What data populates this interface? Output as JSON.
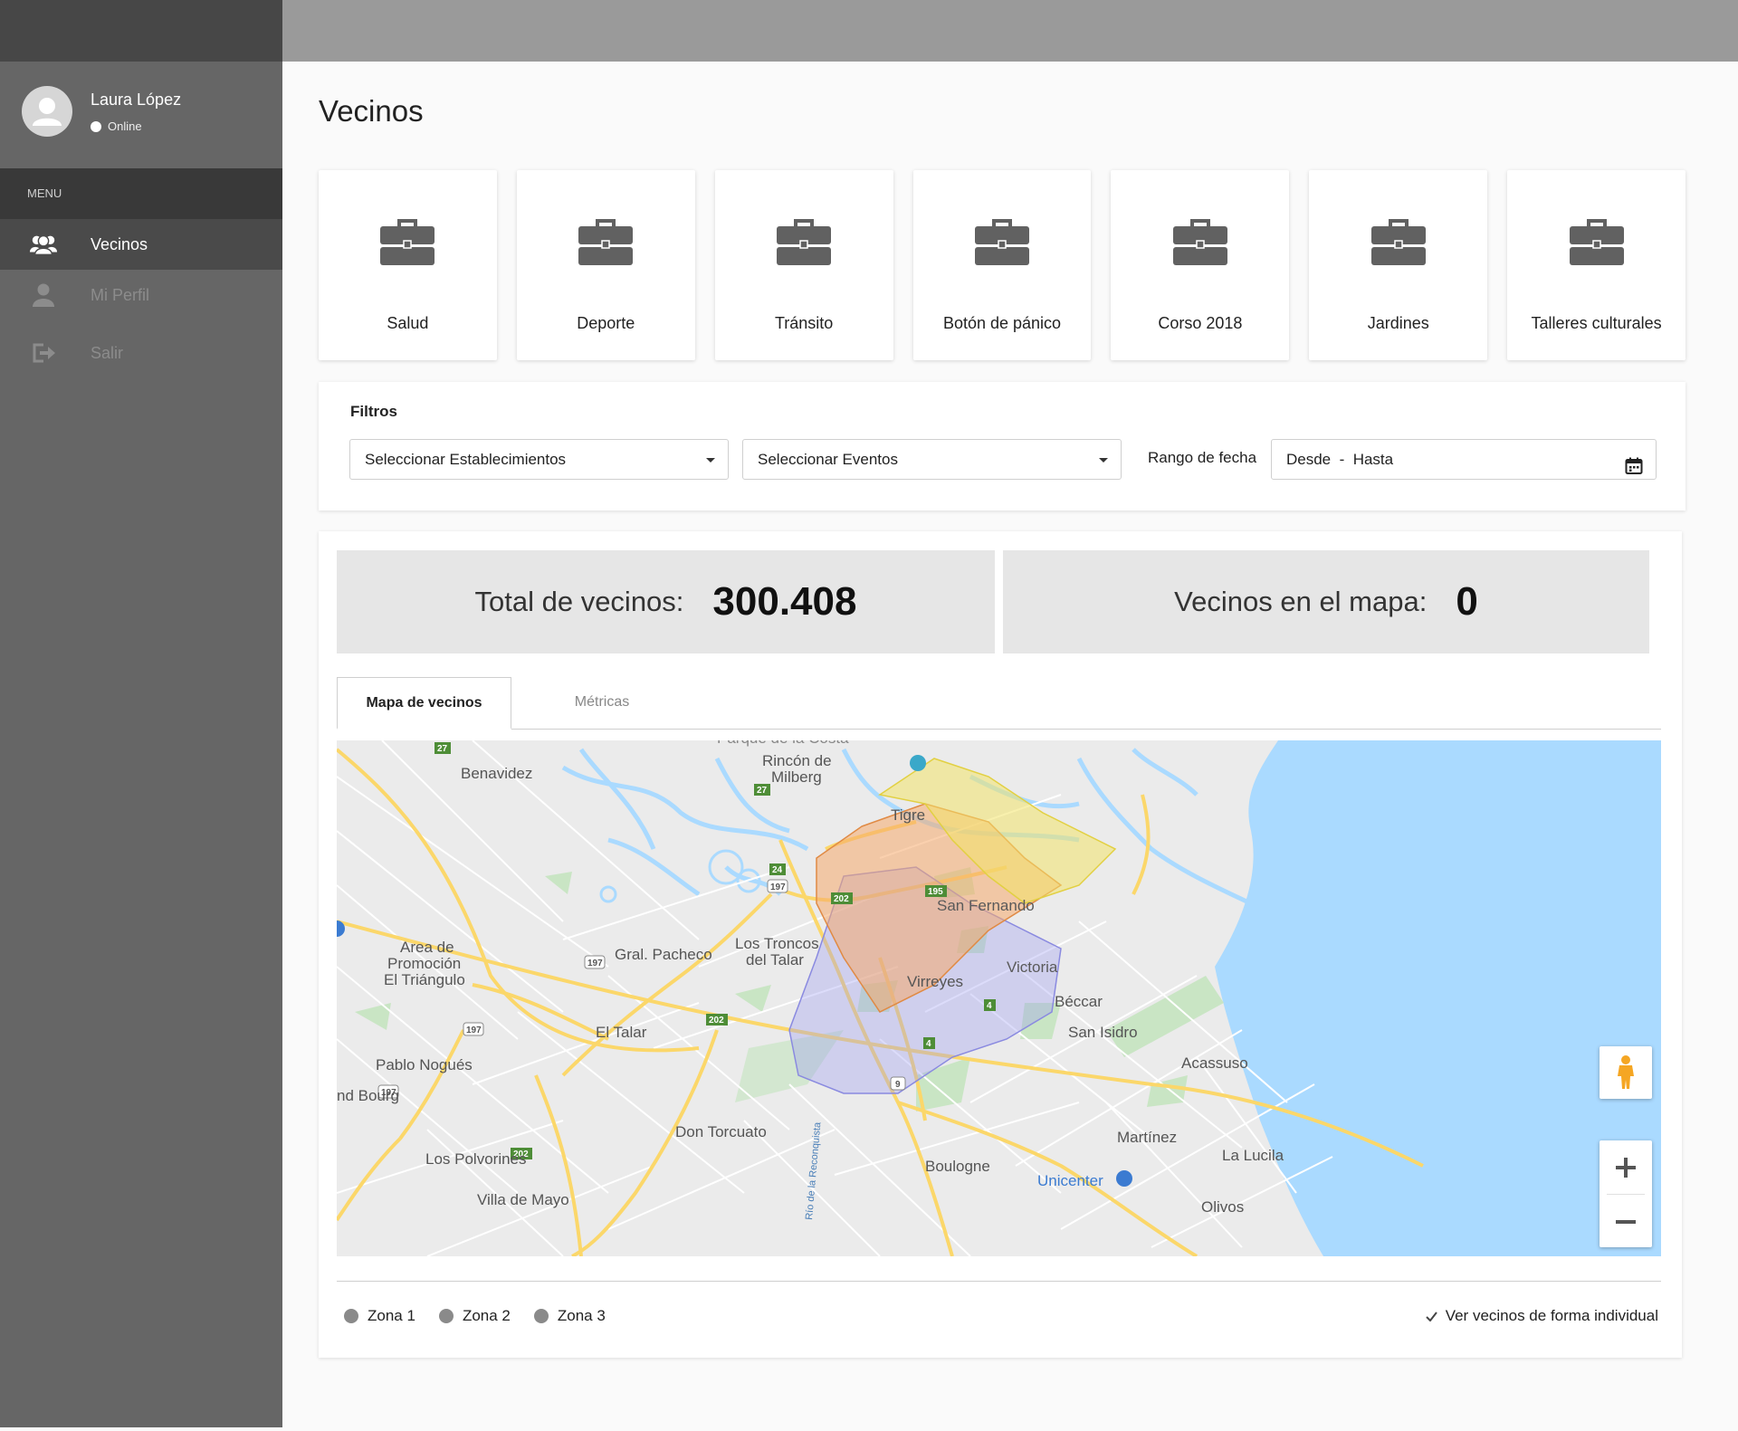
{
  "sidebar": {
    "user": {
      "name": "Laura López",
      "status": "Online"
    },
    "menu_header": "MENU",
    "items": [
      {
        "label": "Vecinos",
        "icon": "users-icon",
        "active": true
      },
      {
        "label": "Mi Perfil",
        "icon": "user-icon",
        "active": false
      },
      {
        "label": "Salir",
        "icon": "logout-icon",
        "active": false
      }
    ]
  },
  "page": {
    "title": "Vecinos"
  },
  "categories": [
    {
      "label": "Salud",
      "icon": "briefcase-icon"
    },
    {
      "label": "Deporte",
      "icon": "briefcase-icon"
    },
    {
      "label": "Tránsito",
      "icon": "briefcase-icon"
    },
    {
      "label": "Botón de pánico",
      "icon": "briefcase-icon"
    },
    {
      "label": "Corso 2018",
      "icon": "briefcase-icon"
    },
    {
      "label": "Jardines",
      "icon": "briefcase-icon"
    },
    {
      "label": "Talleres culturales",
      "icon": "briefcase-icon"
    }
  ],
  "filters": {
    "title": "Filtros",
    "establishments": "Seleccionar Establecimientos",
    "events": "Seleccionar Eventos",
    "date_label": "Rango de fecha",
    "date_value": "Desde  -  Hasta"
  },
  "stats": {
    "total_label": "Total de vecinos:",
    "total_value": "300.408",
    "map_label": "Vecinos en el mapa:",
    "map_value": "0"
  },
  "tabs": [
    {
      "label": "Mapa de vecinos",
      "active": true
    },
    {
      "label": "Métricas",
      "active": false
    }
  ],
  "map": {
    "places": [
      "Parque de la Costa",
      "Rincón de Milberg",
      "Benavidez",
      "Tigre",
      "San Fernando",
      "Victoria",
      "Virreyes",
      "Los Troncos del Talar",
      "Gral. Pacheco",
      "Área de Promoción El Triángulo",
      "El Talar",
      "Béccar",
      "San Isidro",
      "Acassuso",
      "Pablo Nogués",
      "Grand Bourg",
      "Don Torcuato",
      "Martínez",
      "La Lucila",
      "Los Polvorines",
      "Boulogne",
      "Unicenter",
      "Villa de Mayo",
      "Olivos",
      "Río de la Reconquista"
    ],
    "routes": [
      "27",
      "24",
      "197",
      "202",
      "195",
      "4",
      "9"
    ],
    "zone_colors": {
      "zona1": "#b3b3f0",
      "zona2": "#f5a96b",
      "zona3": "#f3e46a"
    },
    "water_color": "#aadaff"
  },
  "legend": {
    "zones": [
      "Zona 1",
      "Zona 2",
      "Zona 3"
    ],
    "individual": "Ver vecinos de forma individual"
  }
}
